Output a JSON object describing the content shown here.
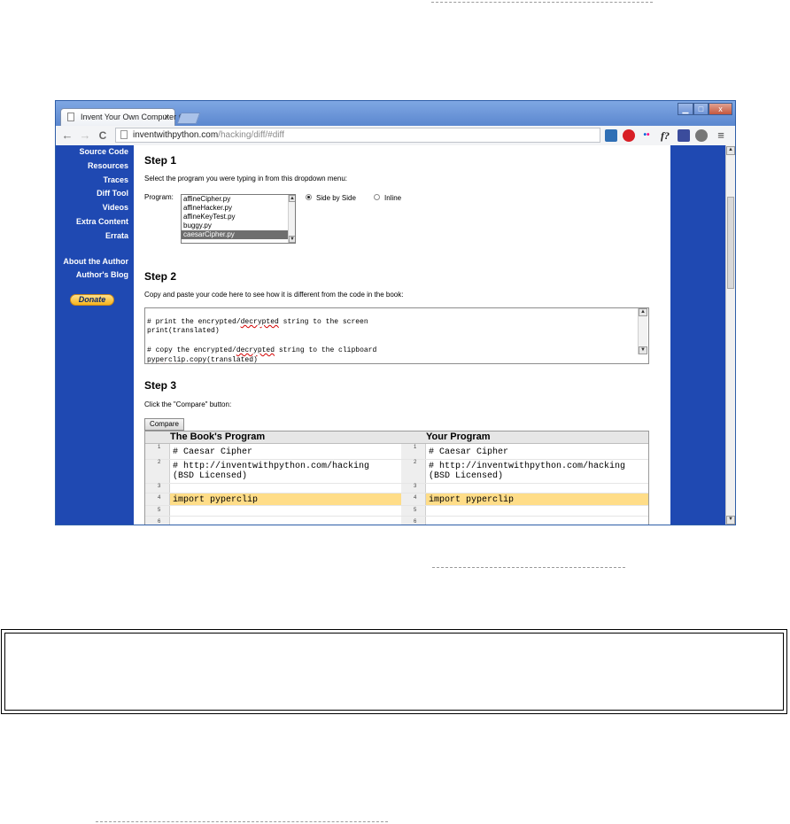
{
  "tab": {
    "title": "Invent Your Own Computer (",
    "close": "×"
  },
  "window_controls": {
    "minimize": "▁",
    "maximize": "□",
    "close": "x"
  },
  "toolbar": {
    "back": "←",
    "forward": "→",
    "reload": "C",
    "url_host": "inventwithpython.com",
    "url_path": "/hacking/diff/#diff",
    "extensions": [
      "monitor-icon",
      "opera-icon",
      "flickr-icon",
      "f?-icon",
      "book-icon",
      "globe-icon"
    ],
    "ext_fx": "f?",
    "menu": "≡"
  },
  "sidebar": {
    "links": [
      "Source Code",
      "Resources",
      "Traces",
      "Diff Tool",
      "Videos",
      "Extra Content",
      "Errata"
    ],
    "about_author": "About the Author",
    "authors_blog": "Author's Blog",
    "donate": "Donate"
  },
  "step1": {
    "heading": "Step 1",
    "instruction": "Select the program you were typing in from this dropdown menu:",
    "program_label": "Program:",
    "options": [
      "affineCipher.py",
      "affineHacker.py",
      "affineKeyTest.py",
      "buggy.py",
      "caesarCipher.py"
    ],
    "selected": "caesarCipher.py",
    "view_side_by_side": "Side by Side",
    "view_inline": "Inline",
    "view_selected": "Side by Side"
  },
  "step2": {
    "heading": "Step 2",
    "instruction": "Copy and paste your code here to see how it is different from the code in the book:",
    "code": {
      "l1_a": "# print the encrypted/",
      "l1_b": "decrypted",
      "l1_c": " string to the screen",
      "l2": "print(translated)",
      "l3": "",
      "l4_a": "# copy the encrypted/",
      "l4_b": "decrypted",
      "l4_c": " string to the clipboard",
      "l5_a": "pyperclip",
      "l5_b": ".copy(translated)"
    }
  },
  "step3": {
    "heading": "Step 3",
    "instruction": "Click the \"Compare\" button:",
    "compare_button": "Compare"
  },
  "diff": {
    "left_header": "The Book's Program",
    "right_header": "Your Program",
    "rows": [
      {
        "num": "1",
        "left": "# Caesar Cipher",
        "right": "# Caesar Cipher"
      },
      {
        "num": "2",
        "left": "# http://inventwithpython.com/hacking",
        "left2": "(BSD Licensed)",
        "right": "# http://inventwithpython.com/hacking",
        "right2": "(BSD Licensed)"
      },
      {
        "num": "3",
        "left": "",
        "right": ""
      },
      {
        "num": "4",
        "left": "import pyperclip",
        "right": "import pyperclip"
      },
      {
        "num": "5",
        "left": "",
        "right": ""
      },
      {
        "num": "6",
        "left": "",
        "right": ""
      }
    ]
  }
}
